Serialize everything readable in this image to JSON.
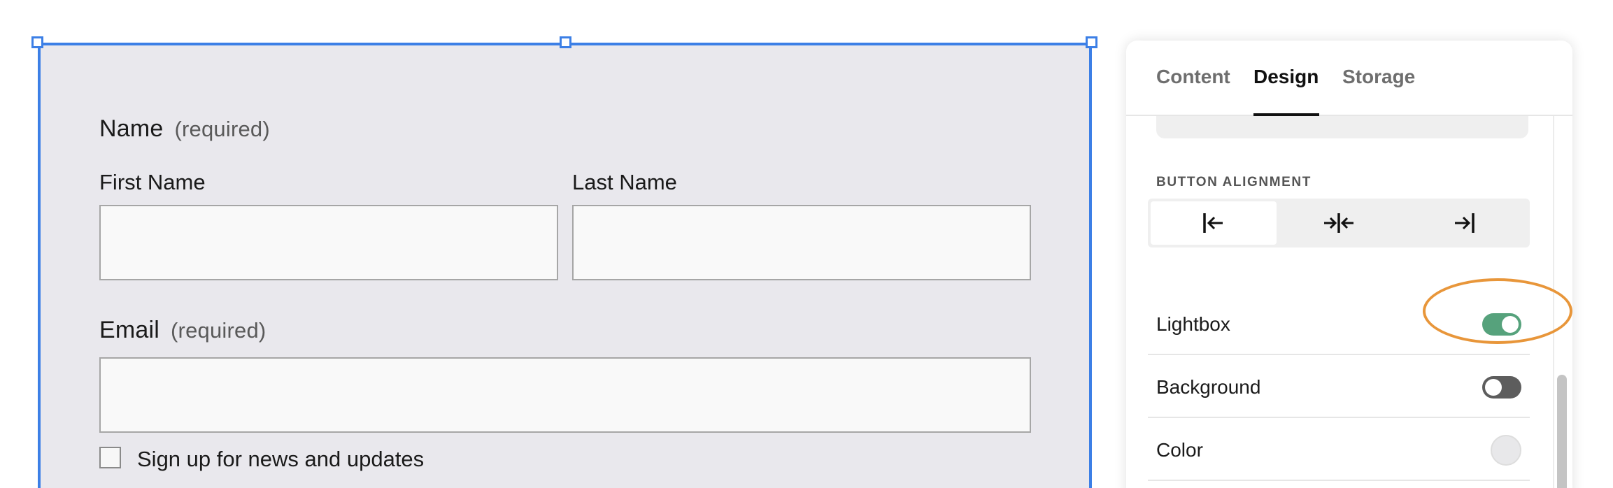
{
  "form": {
    "name_field": {
      "title": "Name",
      "required": "(required)"
    },
    "first_name": {
      "label": "First Name",
      "value": ""
    },
    "last_name": {
      "label": "Last Name",
      "value": ""
    },
    "email_field": {
      "title": "Email",
      "required": "(required)",
      "value": ""
    },
    "newsletter": {
      "label": "Sign up for news and updates",
      "checked": false
    }
  },
  "panel": {
    "tabs": [
      {
        "label": "Content",
        "active": false
      },
      {
        "label": "Design",
        "active": true
      },
      {
        "label": "Storage",
        "active": false
      }
    ],
    "button_alignment": {
      "label": "BUTTON ALIGNMENT",
      "options": [
        {
          "icon": "align-left-icon",
          "selected": true
        },
        {
          "icon": "align-center-icon",
          "selected": false
        },
        {
          "icon": "align-right-icon",
          "selected": false
        }
      ]
    },
    "settings": [
      {
        "label": "Lightbox",
        "control": "toggle",
        "on": true
      },
      {
        "label": "Background",
        "control": "toggle",
        "on": false
      },
      {
        "label": "Color",
        "control": "swatch",
        "color": "#e8e8ea"
      }
    ]
  },
  "colors": {
    "selection": "#3c7fe6",
    "toggle_on": "#56a27c",
    "toggle_off": "#5d5d5d",
    "annotation": "#e8963a",
    "form_bg": "#e9e8ed"
  }
}
